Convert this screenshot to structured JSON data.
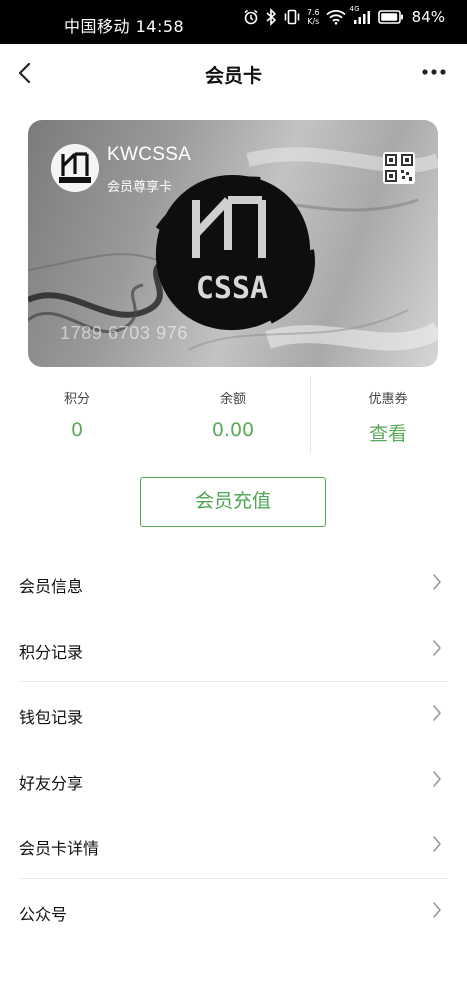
{
  "status_bar": {
    "carrier_time": "中国移动 14:58",
    "net_speed_value": "7.6",
    "net_speed_unit": "K/s",
    "signal_label": "4G",
    "battery": "84%"
  },
  "nav": {
    "title": "会员卡",
    "back_icon": "chevron-left-icon",
    "more_icon": "more-horizontal-icon"
  },
  "card": {
    "brand": "KWCSSA",
    "tier": "会员尊享卡",
    "number": "1789 6703 976",
    "logo_text": "CSSA",
    "qr_icon": "qr-code-icon"
  },
  "stats": [
    {
      "label": "积分",
      "value": "0"
    },
    {
      "label": "余额",
      "value": "0.00"
    },
    {
      "label": "优惠券",
      "value": "查看"
    }
  ],
  "recharge_button": "会员充值",
  "menu": [
    {
      "label": "会员信息"
    },
    {
      "label": "积分记录"
    },
    {
      "label": "钱包记录"
    },
    {
      "label": "好友分享"
    },
    {
      "label": "会员卡详情"
    },
    {
      "label": "公众号"
    }
  ],
  "colors": {
    "accent_green": "#4ea652",
    "stat_value_green": "#5aaa5a",
    "status_bar_bg": "#000000"
  }
}
